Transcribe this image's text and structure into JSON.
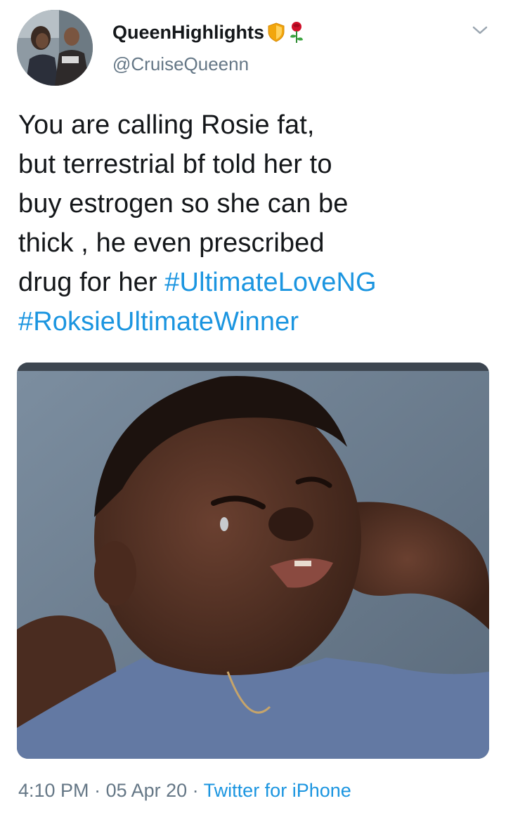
{
  "author": {
    "display_name": "QueenHighlights",
    "handle": "@CruiseQueenn",
    "badges": [
      "shield-emoji",
      "rose-emoji"
    ]
  },
  "tweet": {
    "text_lines": [
      "You are calling Rosie fat,",
      "but terrestrial bf told her to",
      "buy estrogen so she can be",
      "thick , he even prescribed"
    ],
    "last_line_text": "drug for her ",
    "hashtags": [
      "#UltimateLoveNG",
      "#RoksieUltimateWinner"
    ]
  },
  "meta": {
    "time": "4:10 PM",
    "separator": " · ",
    "date": "05 Apr 20",
    "source": "Twitter for iPhone"
  },
  "colors": {
    "link": "#1b95e0",
    "secondary_text": "#657786",
    "primary_text": "#14171a"
  },
  "icons": {
    "menu": "chevron-down-icon"
  }
}
